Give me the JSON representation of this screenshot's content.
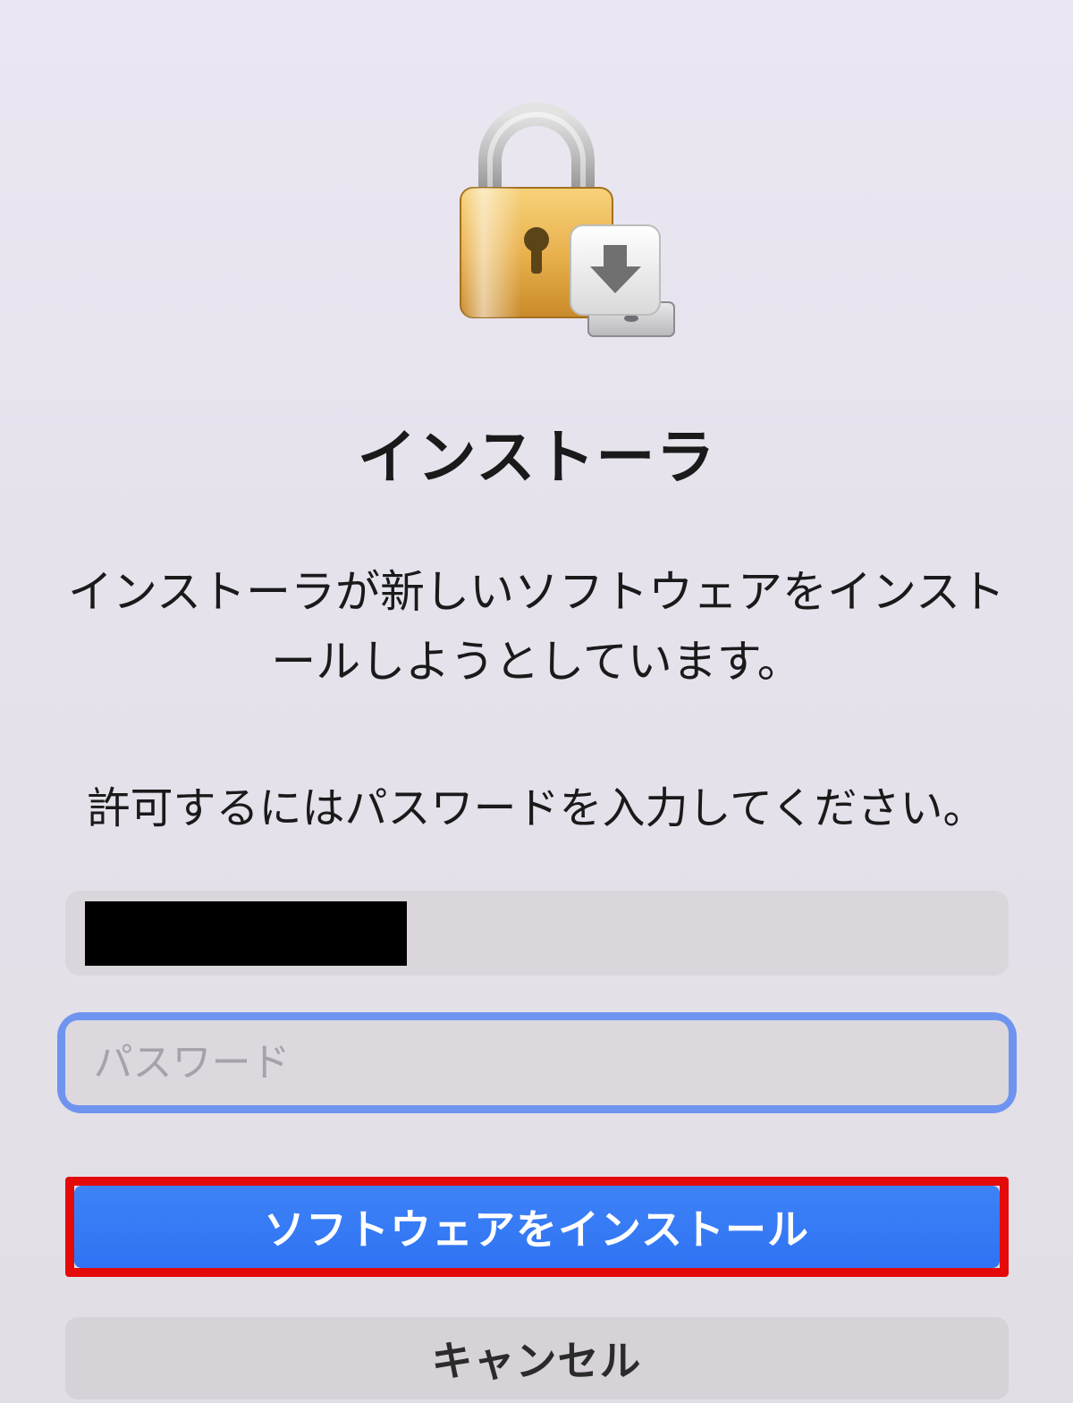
{
  "dialog": {
    "title": "インストーラ",
    "message": "インストーラが新しいソフトウェアをインストールしようとしています。",
    "instruction": "許可するにはパスワードを入力してください。",
    "username_value": "",
    "password_placeholder": "パスワード",
    "install_label": "ソフトウェアをインストール",
    "cancel_label": "キャンセル",
    "icons": {
      "lock": "lock-icon",
      "installer": "installer-download-icon"
    },
    "colors": {
      "primary_button": "#2f73f3",
      "highlight_border": "#e40a0a",
      "focus_ring": "#608cf0"
    }
  }
}
